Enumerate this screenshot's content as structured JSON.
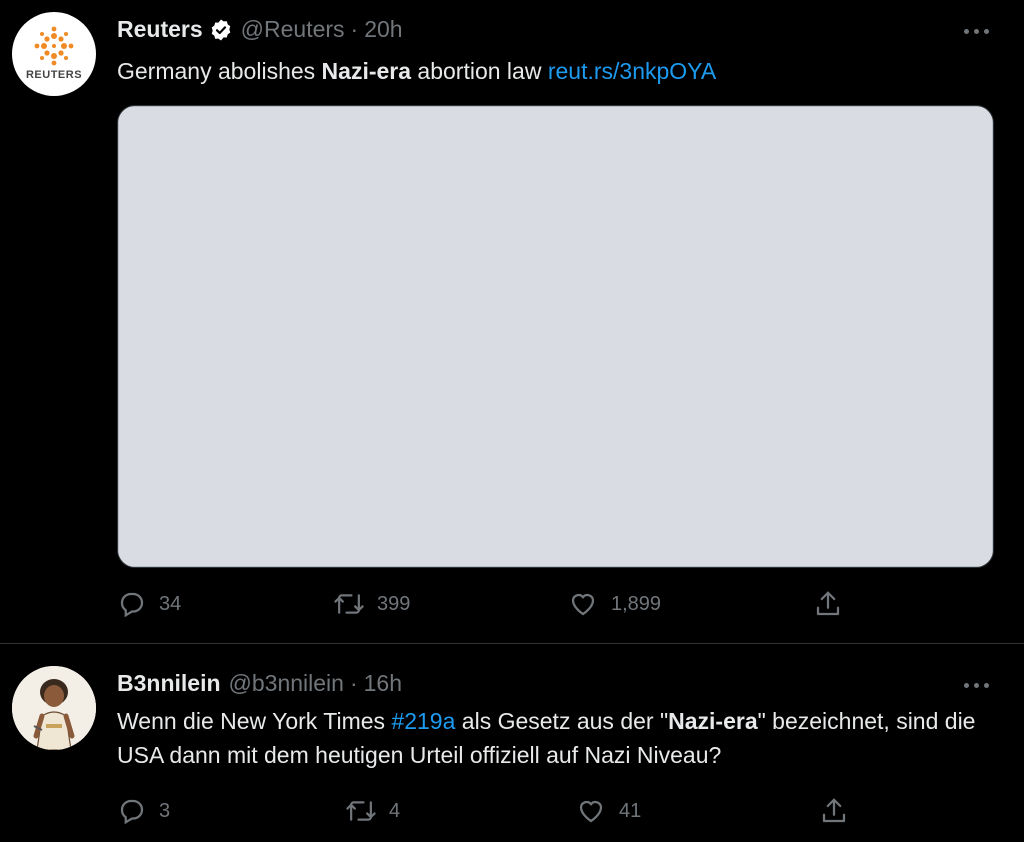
{
  "tweets": [
    {
      "avatar_text": "REUTERS",
      "name": "Reuters",
      "handle": "@Reuters",
      "separator": "·",
      "time": "20h",
      "text_before": "Germany abolishes ",
      "text_bold": "Nazi-era",
      "text_after": " abortion law ",
      "link": "reut.rs/3nkpOYA",
      "stats": {
        "replies": "34",
        "retweets": "399",
        "likes": "1,899"
      }
    },
    {
      "name": "B3nnilein",
      "handle": "@b3nnilein",
      "separator": "·",
      "time": "16h",
      "text_1": "Wenn die New York Times ",
      "hashtag": "#219a",
      "text_2": " als Gesetz aus der \"",
      "text_bold": "Nazi-era",
      "text_3": "\" bezeichnet, sind die USA dann mit dem heutigen Urteil offiziell auf Nazi Niveau?",
      "stats": {
        "replies": "3",
        "retweets": "4",
        "likes": "41"
      }
    }
  ],
  "colors": {
    "background": "#000000",
    "text": "#e7e9ea",
    "muted": "#71767b",
    "link": "#1d9bf0",
    "verified": "#ffffff"
  },
  "icons": [
    "reply-icon",
    "retweet-icon",
    "like-icon",
    "share-icon",
    "verified-icon",
    "more-icon"
  ]
}
